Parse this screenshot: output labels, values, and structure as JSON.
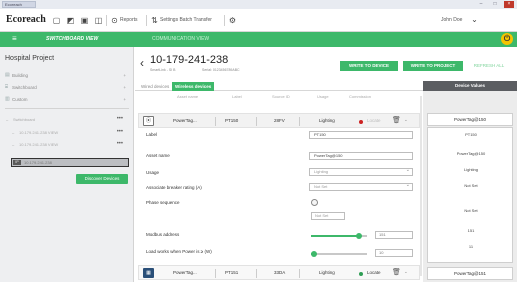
{
  "window": {
    "tab_label": "Ecoreach"
  },
  "toolbar": {
    "logo": "Ecoreach",
    "reports": "Reports",
    "settings": "Settings Batch Transfer",
    "user": "John Doe"
  },
  "nav": {
    "link": "SWITCHBOARD VIEW",
    "crumb": "COMMUNICATION VIEW"
  },
  "sidebar": {
    "project": "Hospital Project",
    "items": [
      {
        "label": "Building"
      },
      {
        "label": "Switchboard"
      },
      {
        "label": "Custom"
      }
    ],
    "tree": [
      {
        "label": "Switchboard"
      },
      {
        "label": "10.179.241.238 VIEW"
      },
      {
        "label": "10.179.241.238 VIEW"
      }
    ],
    "input_tag": "IP",
    "input_value": "10.179.241.238",
    "discover_button": "Discover Devices"
  },
  "device": {
    "title": "10-179-241-238",
    "subtitle": "SmartLink - SI B",
    "serial": "Serial: 0123456789ABC",
    "write_device": "WRITE TO DEVICE",
    "write_project": "WRITE TO PROJECT",
    "refresh": "REFRESH ALL"
  },
  "tabs": {
    "wired": "Wired devices",
    "wireless": "Wireless devices"
  },
  "columns": [
    "Asset name",
    "Label",
    "Source ID",
    "Usage",
    "Commission"
  ],
  "rows": [
    {
      "name": "PowerTag...",
      "label": "PT150",
      "source": "28FV",
      "usage": "Lighting",
      "status": "Locate",
      "status_color": "#cc2222"
    },
    {
      "name": "PowerTag...",
      "label": "PT151",
      "source": "33DA",
      "usage": "Lighting",
      "status": "Locate",
      "status_color": "#2f9e55"
    }
  ],
  "form": {
    "label_label": "Label",
    "label_value": "PT150",
    "asset_label": "Asset name",
    "asset_value": "PowerTag@150",
    "usage_label": "Usage",
    "usage_value": "Lighting",
    "rating_label": "Associate breaker rating (A)",
    "rating_value": "Not Set",
    "phase_label": "Phase sequence",
    "phase_value": "Not Set",
    "modbus_label": "Modbus address",
    "modbus_value": "151",
    "modbus_level": 0.85,
    "load_label": "Load works when Power is ≥ (W)",
    "load_value": "10",
    "load_level": 0.05
  },
  "values_panel": {
    "header": "Device Values",
    "top_value": "PowerTag@150",
    "lines": [
      "PT150",
      "PowerTag@150",
      "Lighting",
      "Not Set",
      "Not Set",
      "151",
      "11"
    ],
    "bottom_value": "PowerTag@151"
  },
  "colors": {
    "accent": "#3db86a",
    "panel_header": "#5b5d61"
  }
}
